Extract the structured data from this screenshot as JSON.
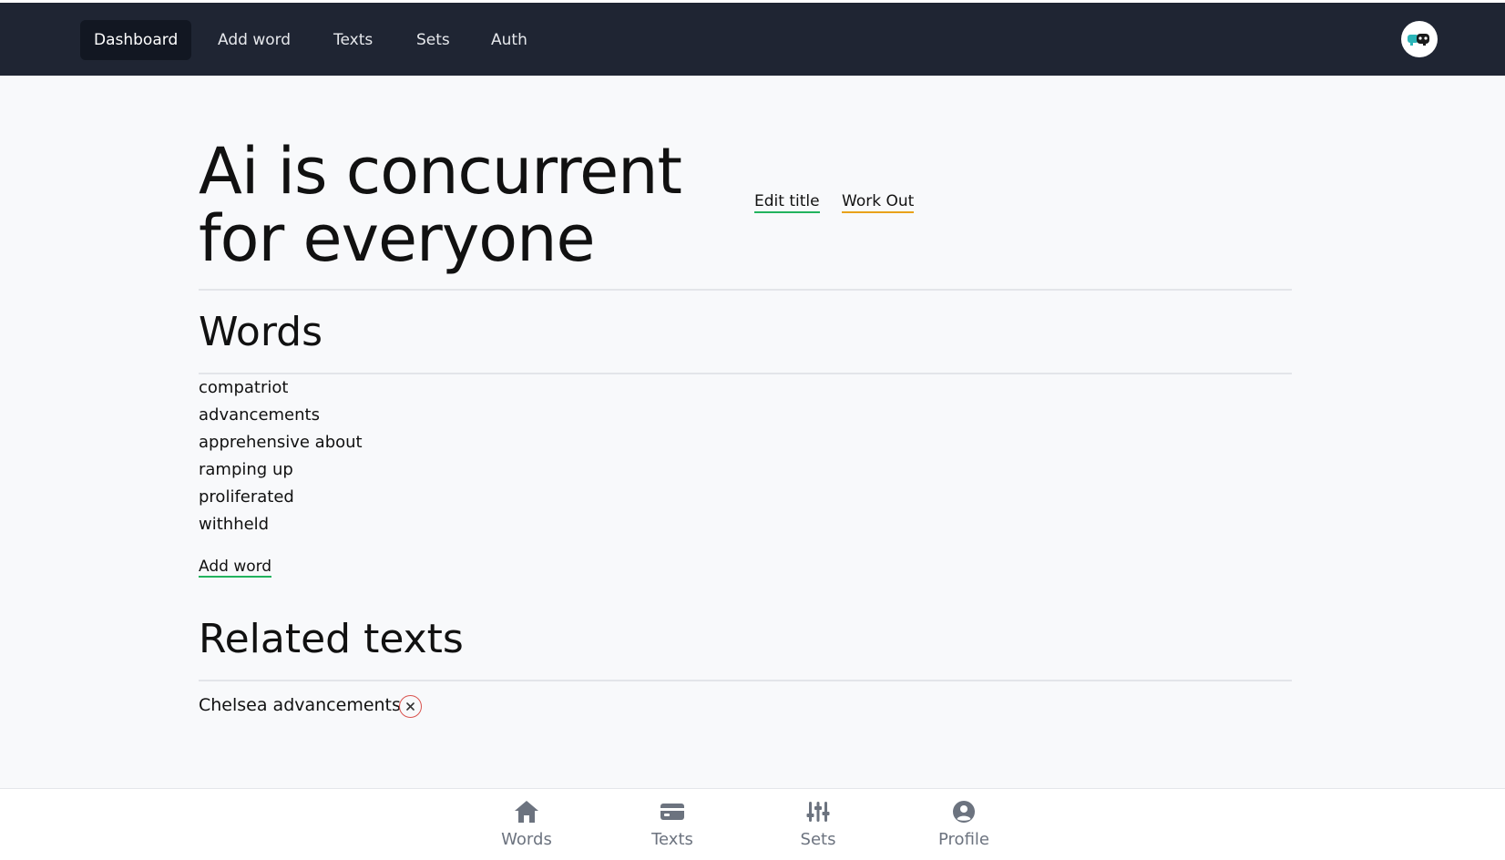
{
  "navbar": {
    "items": [
      {
        "label": "Dashboard",
        "active": true
      },
      {
        "label": "Add word",
        "active": false
      },
      {
        "label": "Texts",
        "active": false
      },
      {
        "label": "Sets",
        "active": false
      },
      {
        "label": "Auth",
        "active": false
      }
    ],
    "avatar_icon": "user-avatar-icon"
  },
  "text": {
    "title": "Ai is concurrent for everyone",
    "actions": {
      "edit_title": "Edit title",
      "work_out": "Work Out"
    }
  },
  "words_section": {
    "heading": "Words",
    "items": [
      "compatriot",
      "advancements",
      "apprehensive about",
      "ramping up",
      "proliferated",
      "withheld"
    ],
    "add_word_label": "Add word"
  },
  "related_section": {
    "heading": "Related texts",
    "items": [
      {
        "title": "Chelsea advancements",
        "remove_icon": "close-icon"
      }
    ]
  },
  "bottom_nav": {
    "items": [
      {
        "label": "Words",
        "icon": "home-icon"
      },
      {
        "label": "Texts",
        "icon": "card-icon"
      },
      {
        "label": "Sets",
        "icon": "sliders-icon"
      },
      {
        "label": "Profile",
        "icon": "profile-icon"
      }
    ]
  },
  "colors": {
    "navbar_bg": "#1f2533",
    "active_nav_bg": "#121722",
    "edit_underline": "#22b35e",
    "workout_underline": "#e8a21a",
    "remove_accent": "#d9534f",
    "bottom_nav_icon": "#6c737f"
  }
}
